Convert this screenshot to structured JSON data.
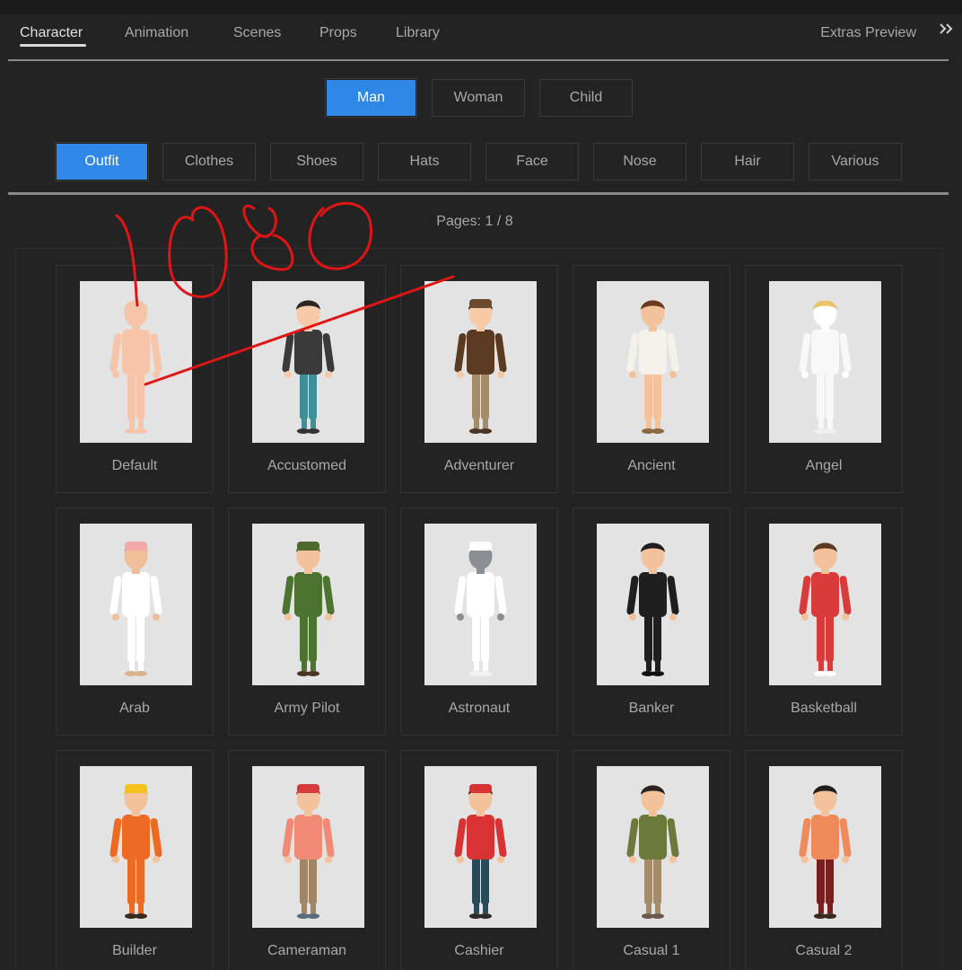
{
  "tabs": [
    {
      "label": "Character",
      "active": true
    },
    {
      "label": "Animation",
      "active": false
    },
    {
      "label": "Scenes",
      "active": false
    },
    {
      "label": "Props",
      "active": false
    },
    {
      "label": "Library",
      "active": false
    }
  ],
  "extras_label": "Extras Preview",
  "genders": [
    {
      "label": "Man",
      "active": true
    },
    {
      "label": "Woman",
      "active": false
    },
    {
      "label": "Child",
      "active": false
    }
  ],
  "categories": [
    {
      "label": "Outfit",
      "active": true
    },
    {
      "label": "Clothes",
      "active": false
    },
    {
      "label": "Shoes",
      "active": false
    },
    {
      "label": "Hats",
      "active": false
    },
    {
      "label": "Face",
      "active": false
    },
    {
      "label": "Nose",
      "active": false
    },
    {
      "label": "Hair",
      "active": false
    },
    {
      "label": "Various",
      "active": false
    }
  ],
  "pages_text": "Pages: 1 / 8",
  "colors": {
    "accent": "#2f87e6",
    "panel_bg": "#232323",
    "thumb_bg": "#e3e3e3",
    "annotation": "#e01515"
  },
  "items": [
    {
      "label": "Default",
      "skin": "#f6c4a8",
      "hair": "#f6c4a8",
      "top": "#f6c4a8",
      "pants": "#f6c4a8",
      "shoes": "#f6c4a8",
      "hat": ""
    },
    {
      "label": "Accustomed",
      "skin": "#f7c9a6",
      "hair": "#2b2420",
      "top": "#3a3a3a",
      "pants": "#3f8e98",
      "shoes": "#333333",
      "hat": ""
    },
    {
      "label": "Adventurer",
      "skin": "#f7c9a6",
      "hair": "#3b2a1e",
      "top": "#5b3a22",
      "pants": "#a48b6c",
      "shoes": "#4a3424",
      "hat": "#6b4a30"
    },
    {
      "label": "Ancient",
      "skin": "#f3c29a",
      "hair": "#6b3b1f",
      "top": "#f4f1ea",
      "pants": "#f3c29a",
      "shoes": "#8a6a45",
      "hat": ""
    },
    {
      "label": "Angel",
      "skin": "#ffffff",
      "hair": "#e8c36a",
      "top": "#f8f8f8",
      "pants": "#f8f8f8",
      "shoes": "#f0f0f0",
      "hat": ""
    },
    {
      "label": "Arab",
      "skin": "#f0bf9a",
      "hair": "#e9a3a3",
      "top": "#ffffff",
      "pants": "#ffffff",
      "shoes": "#d9b38c",
      "hat": "#f0aaaa"
    },
    {
      "label": "Army Pilot",
      "skin": "#f3c29a",
      "hair": "#4d6a2c",
      "top": "#4d7330",
      "pants": "#4d7330",
      "shoes": "#4a3424",
      "hat": "#4d6a2c"
    },
    {
      "label": "Astronaut",
      "skin": "#8a8f96",
      "hair": "#ffffff",
      "top": "#ffffff",
      "pants": "#ffffff",
      "shoes": "#f2f2f2",
      "hat": "#ffffff"
    },
    {
      "label": "Banker",
      "skin": "#f3c29a",
      "hair": "#1e1e1e",
      "top": "#1f1f1f",
      "pants": "#1f1f1f",
      "shoes": "#111111",
      "hat": ""
    },
    {
      "label": "Basketball",
      "skin": "#f3c29a",
      "hair": "#5a3a24",
      "top": "#d93b3b",
      "pants": "#d93b3b",
      "shoes": "#ffffff",
      "hat": ""
    },
    {
      "label": "Builder",
      "skin": "#f3c29a",
      "hair": "#f3c21a",
      "top": "#ec6a21",
      "pants": "#ec6a21",
      "shoes": "#3a2a1e",
      "hat": "#f4c21a"
    },
    {
      "label": "Cameraman",
      "skin": "#f3c29a",
      "hair": "#d63a3a",
      "top": "#f08a74",
      "pants": "#a08566",
      "shoes": "#5a6a7a",
      "hat": "#d63a3a"
    },
    {
      "label": "Cashier",
      "skin": "#f3c29a",
      "hair": "#2b2420",
      "top": "#d93232",
      "pants": "#2a4a5a",
      "shoes": "#2a2a2a",
      "hat": "#d93232"
    },
    {
      "label": "Casual 1",
      "skin": "#f3c29a",
      "hair": "#2b2420",
      "top": "#6b7a3a",
      "pants": "#a48b6c",
      "shoes": "#6a5a4a",
      "hat": ""
    },
    {
      "label": "Casual 2",
      "skin": "#f3c29a",
      "hair": "#1e1e1e",
      "top": "#f08a5a",
      "pants": "#7a1f1f",
      "shoes": "#3a2a1e",
      "hat": ""
    }
  ]
}
